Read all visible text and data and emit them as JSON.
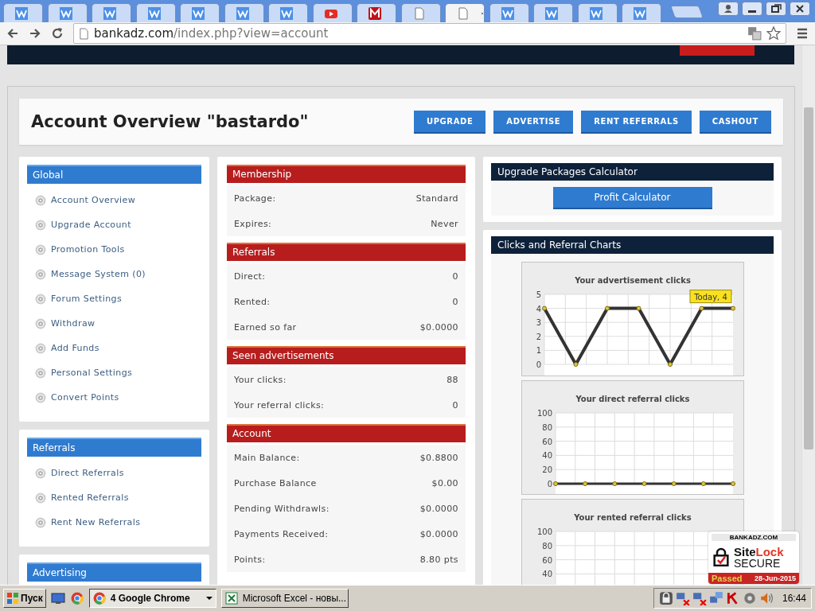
{
  "browser": {
    "tabs": [
      {
        "kind": "w",
        "selected": false
      },
      {
        "kind": "w",
        "selected": false
      },
      {
        "kind": "w",
        "selected": false
      },
      {
        "kind": "w",
        "selected": false
      },
      {
        "kind": "w",
        "selected": false
      },
      {
        "kind": "w",
        "selected": false
      },
      {
        "kind": "w",
        "selected": false
      },
      {
        "kind": "video",
        "selected": false
      },
      {
        "kind": "mail",
        "selected": false
      },
      {
        "kind": "page",
        "selected": false
      },
      {
        "kind": "page",
        "selected": true
      },
      {
        "kind": "w",
        "selected": false
      },
      {
        "kind": "w",
        "selected": false
      },
      {
        "kind": "w",
        "selected": false
      },
      {
        "kind": "w",
        "selected": false
      }
    ],
    "address": {
      "domain": "bankadz.com",
      "path": "/index.php?view=account"
    }
  },
  "page": {
    "title": "Account Overview \"bastardo\"",
    "buttons": [
      "UPGRADE",
      "ADVERTISE",
      "RENT REFERRALS",
      "CASHOUT"
    ],
    "menus": [
      {
        "title": "Global",
        "items": [
          "Account Overview",
          "Upgrade Account",
          "Promotion Tools",
          "Message System (0)",
          "Forum Settings",
          "Withdraw",
          "Add Funds",
          "Personal Settings",
          "Convert Points"
        ]
      },
      {
        "title": "Referrals",
        "items": [
          "Direct Referrals",
          "Rented Referrals",
          "Rent New Referrals"
        ]
      },
      {
        "title": "Advertising"
      }
    ],
    "stats": [
      {
        "title": "Membership",
        "rows": [
          {
            "label": "Package:",
            "value": "Standard"
          },
          {
            "label": "Expires:",
            "value": "Never"
          }
        ]
      },
      {
        "title": "Referrals",
        "rows": [
          {
            "label": "Direct:",
            "value": "0"
          },
          {
            "label": "Rented:",
            "value": "0"
          },
          {
            "label": "Earned so far",
            "value": "$0.0000"
          }
        ]
      },
      {
        "title": "Seen advertisements",
        "rows": [
          {
            "label": "Your clicks:",
            "value": "88"
          },
          {
            "label": "Your referral clicks:",
            "value": "0"
          }
        ]
      },
      {
        "title": "Account",
        "rows": [
          {
            "label": "Main Balance:",
            "value": "$0.8800"
          },
          {
            "label": "Purchase Balance",
            "value": "$0.00"
          },
          {
            "label": "Pending Withdrawls:",
            "value": "$0.0000"
          },
          {
            "label": "Payments Received:",
            "value": "$0.0000"
          },
          {
            "label": "Points:",
            "value": "8.80 pts"
          }
        ]
      }
    ],
    "calculator": {
      "title": "Upgrade Packages Calculator",
      "button": "Profit Calculator"
    },
    "charts_panel": {
      "title": "Clicks and Referral Charts",
      "charts": [
        {
          "chart_data": {
            "type": "line",
            "title": "Your advertisement clicks",
            "series": [
              {
                "color": "#333333",
                "values": [
                  4,
                  0,
                  4,
                  4,
                  0,
                  4,
                  4
                ]
              }
            ],
            "ylim": [
              0,
              5
            ],
            "yticks": [
              0,
              1,
              2,
              3,
              4,
              5
            ],
            "grid": true,
            "marker": true,
            "annotations": [
              {
                "text": "Today, 4"
              }
            ]
          }
        },
        {
          "chart_data": {
            "type": "line",
            "title": "Your direct referral clicks",
            "series": [
              {
                "color": "#333333",
                "values": [
                  0,
                  0,
                  0,
                  0,
                  0,
                  0,
                  0
                ]
              }
            ],
            "ylim": [
              0,
              100
            ],
            "yticks": [
              0,
              20,
              40,
              60,
              80,
              100
            ],
            "grid": true,
            "marker": true
          }
        },
        {
          "title": "Your rented referral clicks",
          "axis_labels": [
            "100",
            "80",
            "60",
            "40"
          ]
        }
      ]
    },
    "sitelock": {
      "site": "BANKADZ.COM",
      "brand_a": "Site",
      "brand_b": "Lock",
      "secure": "SECURE",
      "status": "Passed",
      "date": "28-Jun-2015"
    }
  },
  "taskbar": {
    "start": "Пуск",
    "windows": [
      {
        "label": "4 Google Chrome",
        "kind": "chrome",
        "selected": true
      },
      {
        "label": "Microsoft Excel - новы...",
        "kind": "excel",
        "selected": false
      }
    ],
    "clock": "16:44"
  }
}
